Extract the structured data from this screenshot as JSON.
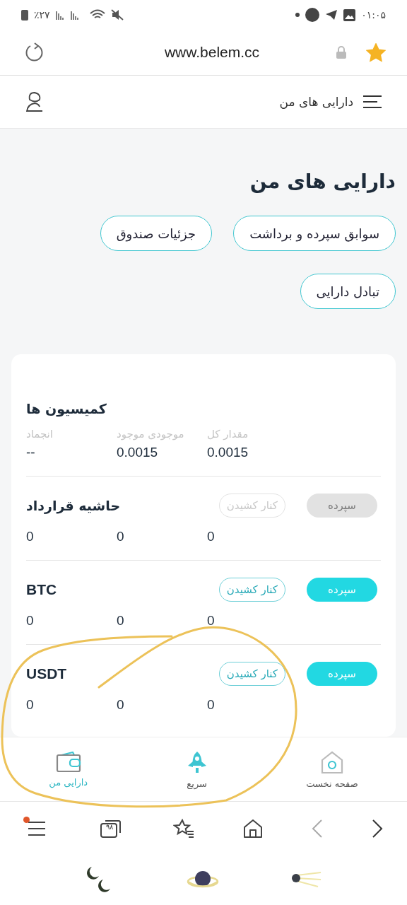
{
  "status_bar": {
    "battery": "٪۲۷",
    "time": "۰۱:۰۵"
  },
  "browser": {
    "url": "www.belem.cc",
    "bookmarked": true
  },
  "header": {
    "title": "دارایی های من"
  },
  "page_title": "دارایی های من",
  "actions": [
    {
      "label": "سوابق سپرده و برداشت"
    },
    {
      "label": "جزئیات صندوق"
    },
    {
      "label": "تبادل دارایی"
    }
  ],
  "sections": [
    {
      "kind": "labeled",
      "name": "کمیسیون ها",
      "columns": [
        "مقدار کل",
        "موجودی موجود",
        "انجماد"
      ],
      "values": [
        "0.0015",
        "0.0015",
        "--"
      ]
    },
    {
      "kind": "asset",
      "name": "حاشیه قرارداد",
      "deposit": {
        "label": "سپرده",
        "disabled": true
      },
      "withdraw": {
        "label": "کنار کشیدن",
        "disabled": true
      },
      "values": [
        "0",
        "0",
        "0"
      ]
    },
    {
      "kind": "asset",
      "name": "BTC",
      "deposit": {
        "label": "سپرده",
        "disabled": false
      },
      "withdraw": {
        "label": "کنار کشیدن",
        "disabled": false
      },
      "values": [
        "0",
        "0",
        "0"
      ]
    },
    {
      "kind": "asset",
      "name": "USDT",
      "deposit": {
        "label": "سپرده",
        "disabled": false
      },
      "withdraw": {
        "label": "کنار کشیدن",
        "disabled": false
      },
      "values": [
        "0",
        "0",
        "0"
      ]
    }
  ],
  "bottom_nav": [
    {
      "kind": "home",
      "label": "صفحه نخست",
      "selected": false
    },
    {
      "kind": "rocket",
      "label": "سریع",
      "selected": false
    },
    {
      "kind": "wallet",
      "label": "دارایی من",
      "selected": true
    }
  ],
  "browser_toolbar": {
    "tab_count": "۹۸",
    "menu_badge": true
  }
}
